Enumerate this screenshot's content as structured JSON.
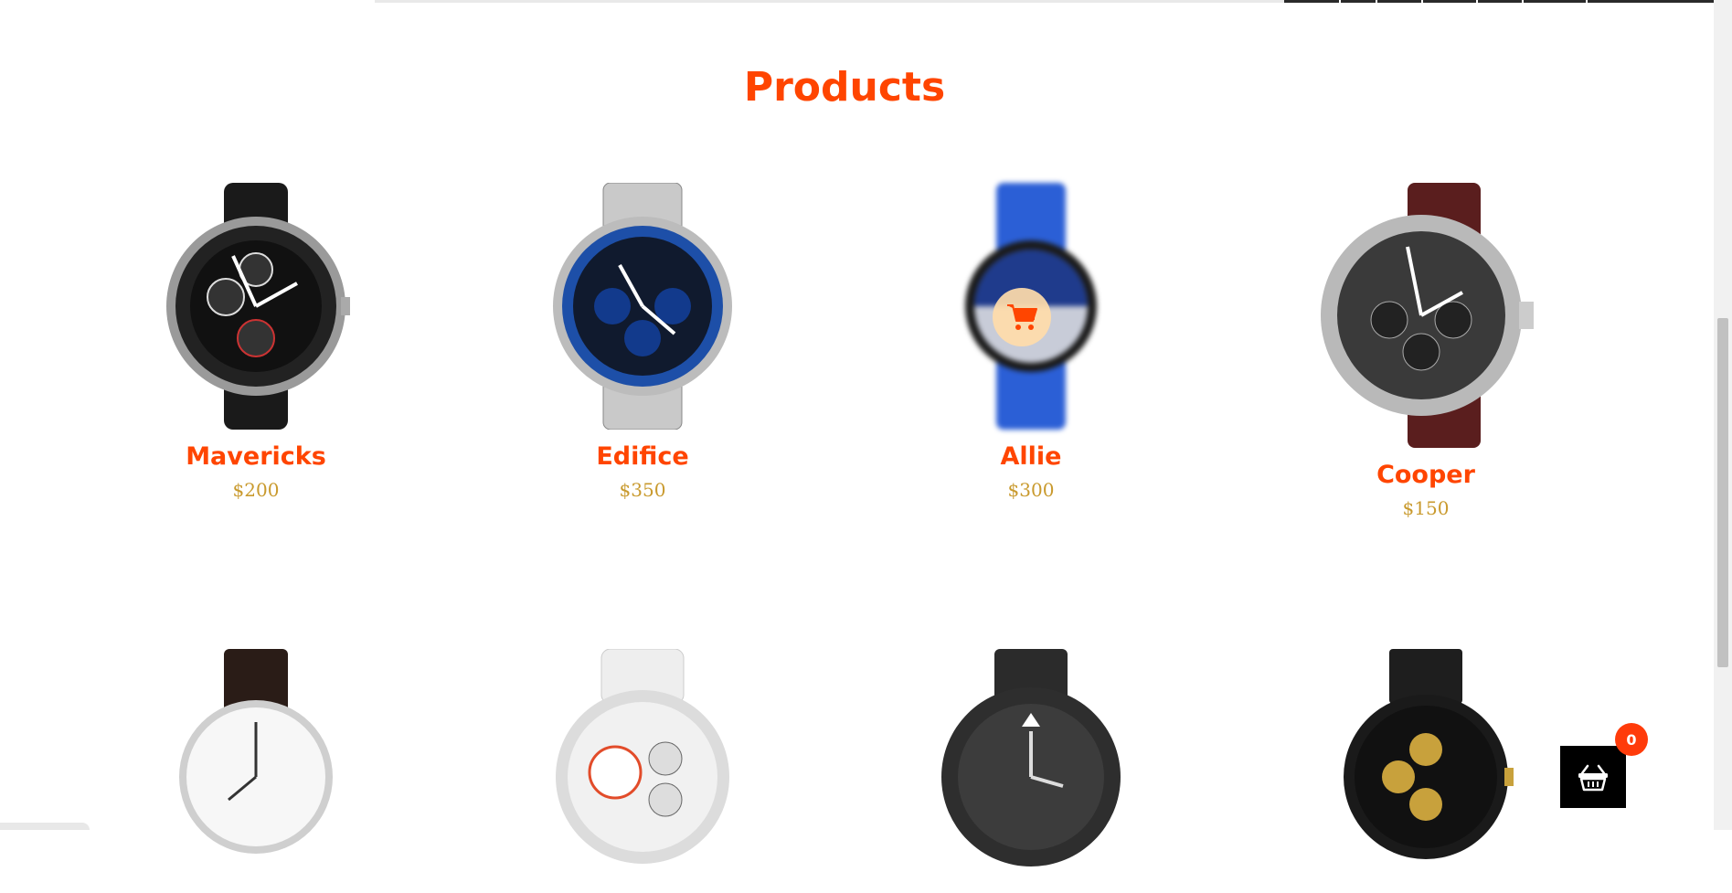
{
  "products_section": {
    "title": "Products",
    "items": [
      {
        "name": "Mavericks",
        "price": "$200"
      },
      {
        "name": "Edifice",
        "price": "$350"
      },
      {
        "name": "Allie",
        "price": "$300"
      },
      {
        "name": "Cooper",
        "price": "$150"
      },
      {
        "name": "",
        "price": ""
      },
      {
        "name": "",
        "price": ""
      },
      {
        "name": "",
        "price": ""
      },
      {
        "name": "",
        "price": ""
      }
    ]
  },
  "cart": {
    "count": "0",
    "icon": "basket-icon"
  },
  "colors": {
    "accent": "#ff4500",
    "price": "#c99a2e",
    "badge": "#ff3b0a"
  }
}
